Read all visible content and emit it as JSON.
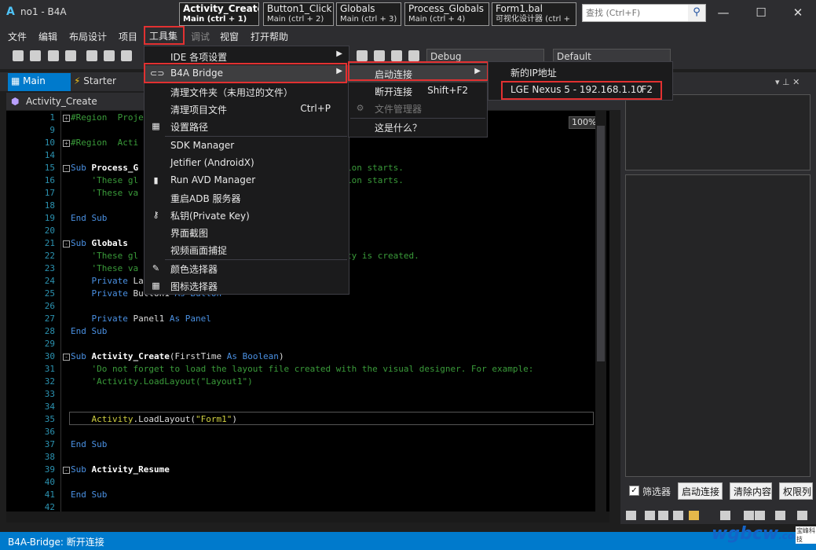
{
  "window": {
    "title": "no1 - B4A",
    "logo": "A",
    "quick_tabs": [
      {
        "title": "Activity_Create",
        "sub": "Main  (ctrl + 1)",
        "active": true
      },
      {
        "title": "Button1_Click",
        "sub": "Main  (ctrl + 2)",
        "active": false
      },
      {
        "title": "Globals",
        "sub": "Main  (ctrl + 3)",
        "active": false
      },
      {
        "title": "Process_Globals",
        "sub": "Main  (ctrl + 4)",
        "active": false
      },
      {
        "title": "Form1.bal",
        "sub": "可视化设计器 (ctrl +",
        "active": false
      }
    ],
    "search_placeholder": "查找 (Ctrl+F)",
    "controls": {
      "minimize": "—",
      "maximize": "☐",
      "close": "✕"
    }
  },
  "menubar": [
    "文件",
    "编辑",
    "布局设计",
    "项目",
    "工具集",
    "调试",
    "视窗",
    "打开帮助"
  ],
  "toolbar": {
    "build_config": "Debug",
    "device_config": "Default"
  },
  "doc_tabs": {
    "main": "Main",
    "starter": "Starter"
  },
  "module_header": "Activity_Create",
  "editor": {
    "zoom": "100%",
    "lines": [
      {
        "n": "1",
        "segs": [
          [
            "cm",
            "#Region  Proje"
          ]
        ],
        "fold": "+"
      },
      {
        "n": "9",
        "segs": []
      },
      {
        "n": "10",
        "segs": [
          [
            "cm",
            "#Region  Acti"
          ]
        ],
        "fold": "+"
      },
      {
        "n": "14",
        "segs": []
      },
      {
        "n": "15",
        "segs": [
          [
            "kw",
            "Sub "
          ],
          [
            "fn",
            "Process_G"
          ],
          [
            "pl",
            "                        "
          ],
          [
            "cm",
            "hen the application starts."
          ]
        ],
        "fold": "-"
      },
      {
        "n": "16",
        "segs": [
          [
            "cm",
            "    'These gl"
          ],
          [
            "pl",
            "                        "
          ],
          [
            "cm",
            "hen the application starts."
          ]
        ]
      },
      {
        "n": "17",
        "segs": [
          [
            "cm",
            "    'These va"
          ],
          [
            "pl",
            "                        "
          ],
          [
            "cm",
            "es."
          ]
        ]
      },
      {
        "n": "18",
        "segs": []
      },
      {
        "n": "19",
        "segs": [
          [
            "kw",
            "End Sub"
          ]
        ]
      },
      {
        "n": "20",
        "segs": []
      },
      {
        "n": "21",
        "segs": [
          [
            "kw",
            "Sub "
          ],
          [
            "fn",
            "Globals"
          ]
        ],
        "fold": "-"
      },
      {
        "n": "22",
        "segs": [
          [
            "cm",
            "    'These gl"
          ],
          [
            "pl",
            "                        "
          ],
          [
            "cm",
            " time the activity is created."
          ]
        ]
      },
      {
        "n": "23",
        "segs": [
          [
            "cm",
            "    'These va"
          ],
          [
            "pl",
            "                        "
          ],
          [
            "cm",
            " module."
          ]
        ]
      },
      {
        "n": "24",
        "segs": [
          [
            "kw",
            "    Private "
          ],
          [
            "pl",
            "La"
          ]
        ]
      },
      {
        "n": "25",
        "segs": [
          [
            "kw",
            "    Private "
          ],
          [
            "pl",
            "Button1 "
          ],
          [
            "kw",
            "As Button"
          ]
        ]
      },
      {
        "n": "26",
        "segs": []
      },
      {
        "n": "27",
        "segs": [
          [
            "kw",
            "    Private "
          ],
          [
            "pl",
            "Panel1 "
          ],
          [
            "kw",
            "As Panel"
          ]
        ]
      },
      {
        "n": "28",
        "segs": [
          [
            "kw",
            "End Sub"
          ]
        ]
      },
      {
        "n": "29",
        "segs": []
      },
      {
        "n": "30",
        "segs": [
          [
            "kw",
            "Sub "
          ],
          [
            "fn",
            "Activity_Create"
          ],
          [
            "pl",
            "(FirstTime "
          ],
          [
            "kw",
            "As Boolean"
          ],
          [
            "pl",
            ")"
          ]
        ],
        "fold": "-"
      },
      {
        "n": "31",
        "segs": [
          [
            "cm",
            "    'Do not forget to load the layout file created with the visual designer. For example:"
          ]
        ]
      },
      {
        "n": "32",
        "segs": [
          [
            "cm",
            "    'Activity.LoadLayout(\"Layout1\")"
          ]
        ]
      },
      {
        "n": "33",
        "segs": []
      },
      {
        "n": "34",
        "segs": []
      },
      {
        "n": "35",
        "segs": [
          [
            "st",
            "    Activity"
          ],
          [
            "pl",
            ".LoadLayout("
          ],
          [
            "st",
            "\"Form1\""
          ],
          [
            "pl",
            ")"
          ]
        ]
      },
      {
        "n": "36",
        "segs": []
      },
      {
        "n": "37",
        "segs": [
          [
            "kw",
            "End Sub"
          ]
        ]
      },
      {
        "n": "38",
        "segs": []
      },
      {
        "n": "39",
        "segs": [
          [
            "kw",
            "Sub "
          ],
          [
            "fn",
            "Activity_Resume"
          ]
        ],
        "fold": "-"
      },
      {
        "n": "40",
        "segs": []
      },
      {
        "n": "41",
        "segs": [
          [
            "kw",
            "End Sub"
          ]
        ]
      },
      {
        "n": "42",
        "segs": []
      }
    ]
  },
  "tools_menu": [
    {
      "label": "IDE 各项设置",
      "arrow": "▶"
    },
    {
      "label": "B4A Bridge",
      "arrow": "▶",
      "icon": "⊂⊃"
    },
    {
      "label": "清理文件夹（未用过的文件）"
    },
    {
      "label": "清理项目文件",
      "shortcut": "Ctrl+P"
    },
    {
      "label": "设置路径",
      "icon": "▦"
    },
    {
      "label": "SDK Manager"
    },
    {
      "label": "Jetifier (AndroidX)"
    },
    {
      "label": "Run AVD Manager",
      "icon": "▮"
    },
    {
      "label": "重启ADB 服务器"
    },
    {
      "label": "私钥(Private Key)",
      "icon": "⚷"
    },
    {
      "label": "界面截图"
    },
    {
      "label": "视频画面捕捉"
    },
    {
      "label": "颜色选择器",
      "icon": "✎"
    },
    {
      "label": "图标选择器",
      "icon": "▦"
    }
  ],
  "bridge_menu": [
    {
      "label": "启动连接",
      "arrow": "▶"
    },
    {
      "label": "断开连接",
      "shortcut": "Shift+F2"
    },
    {
      "label": "文件管理器",
      "disabled": true
    },
    {
      "label": "这是什么？"
    }
  ],
  "connect_menu": [
    {
      "label": "新的IP地址"
    },
    {
      "label": "LGE Nexus 5 - 192.168.1.10",
      "shortcut": "F2"
    }
  ],
  "right_panel": {
    "filter_check": "✓",
    "filter_label": "筛选器",
    "buttons": [
      "启动连接",
      "清除内容",
      "权限列"
    ]
  },
  "status": "B4A-Bridge: 断开连接",
  "watermark": {
    "text": "wgbcw",
    "suffix": ".com",
    "brand": "宝峰科技"
  }
}
